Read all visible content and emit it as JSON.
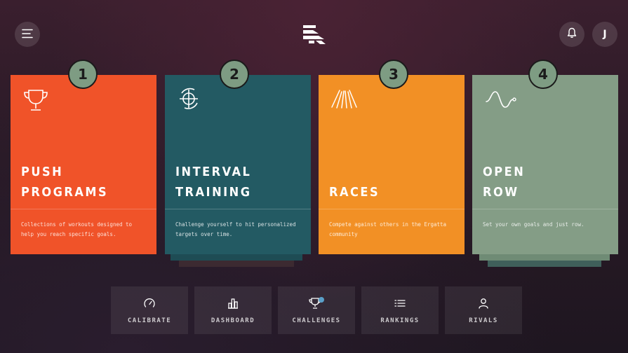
{
  "header": {
    "menu_icon": "hamburger-icon",
    "logo": "ergatta-logo",
    "bell_icon": "bell-icon",
    "avatar_initial": "J"
  },
  "cards": [
    {
      "number": "1",
      "title_line1": "PUSH",
      "title_line2": "PROGRAMS",
      "description": "Collections of workouts designed to help you reach specific goals.",
      "icon": "trophy-icon",
      "color": "#f05329"
    },
    {
      "number": "2",
      "title_line1": "INTERVAL",
      "title_line2": "TRAINING",
      "description": "Challenge yourself to hit personalized targets over time.",
      "icon": "target-icon",
      "color": "#235a63"
    },
    {
      "number": "3",
      "title_line1": "",
      "title_line2": "RACES",
      "description": "Compete against others in the Ergatta community",
      "icon": "race-lanes-icon",
      "color": "#f29025"
    },
    {
      "number": "4",
      "title_line1": "OPEN",
      "title_line2": "ROW",
      "description": "Set your own goals and just row.",
      "icon": "wave-icon",
      "color": "#849d86"
    }
  ],
  "nav": [
    {
      "label": "CALIBRATE",
      "icon": "gauge-icon"
    },
    {
      "label": "DASHBOARD",
      "icon": "bar-chart-icon"
    },
    {
      "label": "CHALLENGES",
      "icon": "trophy-icon"
    },
    {
      "label": "RANKINGS",
      "icon": "list-icon"
    },
    {
      "label": "RIVALS",
      "icon": "person-icon"
    }
  ]
}
